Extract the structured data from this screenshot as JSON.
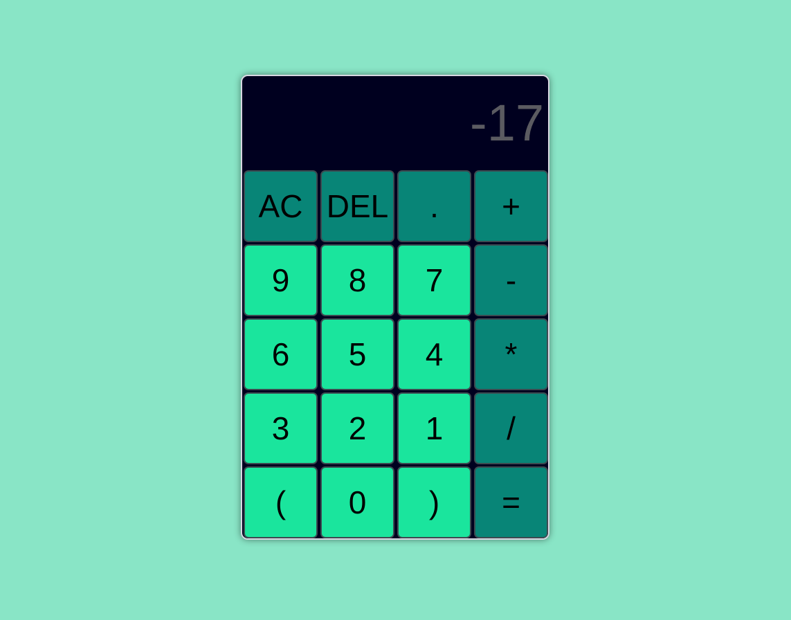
{
  "display": {
    "value": "-17"
  },
  "colors": {
    "page_background": "#89e5c6",
    "calculator_background": "#00001f",
    "digit_key": "#1ae59d",
    "operator_key": "#088577",
    "display_text": "#5b5b61"
  },
  "keys": [
    {
      "label": "AC",
      "kind": "op",
      "name": "all-clear-button"
    },
    {
      "label": "DEL",
      "kind": "op",
      "name": "delete-button"
    },
    {
      "label": ".",
      "kind": "op",
      "name": "decimal-button"
    },
    {
      "label": "+",
      "kind": "op",
      "name": "add-button"
    },
    {
      "label": "9",
      "kind": "digit",
      "name": "digit-9-button"
    },
    {
      "label": "8",
      "kind": "digit",
      "name": "digit-8-button"
    },
    {
      "label": "7",
      "kind": "digit",
      "name": "digit-7-button"
    },
    {
      "label": "-",
      "kind": "op",
      "name": "subtract-button"
    },
    {
      "label": "6",
      "kind": "digit",
      "name": "digit-6-button"
    },
    {
      "label": "5",
      "kind": "digit",
      "name": "digit-5-button"
    },
    {
      "label": "4",
      "kind": "digit",
      "name": "digit-4-button"
    },
    {
      "label": "*",
      "kind": "op",
      "name": "multiply-button"
    },
    {
      "label": "3",
      "kind": "digit",
      "name": "digit-3-button"
    },
    {
      "label": "2",
      "kind": "digit",
      "name": "digit-2-button"
    },
    {
      "label": "1",
      "kind": "digit",
      "name": "digit-1-button"
    },
    {
      "label": "/",
      "kind": "op",
      "name": "divide-button"
    },
    {
      "label": "(",
      "kind": "digit",
      "name": "open-paren-button"
    },
    {
      "label": "0",
      "kind": "digit",
      "name": "digit-0-button"
    },
    {
      "label": ")",
      "kind": "digit",
      "name": "close-paren-button"
    },
    {
      "label": "=",
      "kind": "op",
      "name": "equals-button"
    }
  ]
}
